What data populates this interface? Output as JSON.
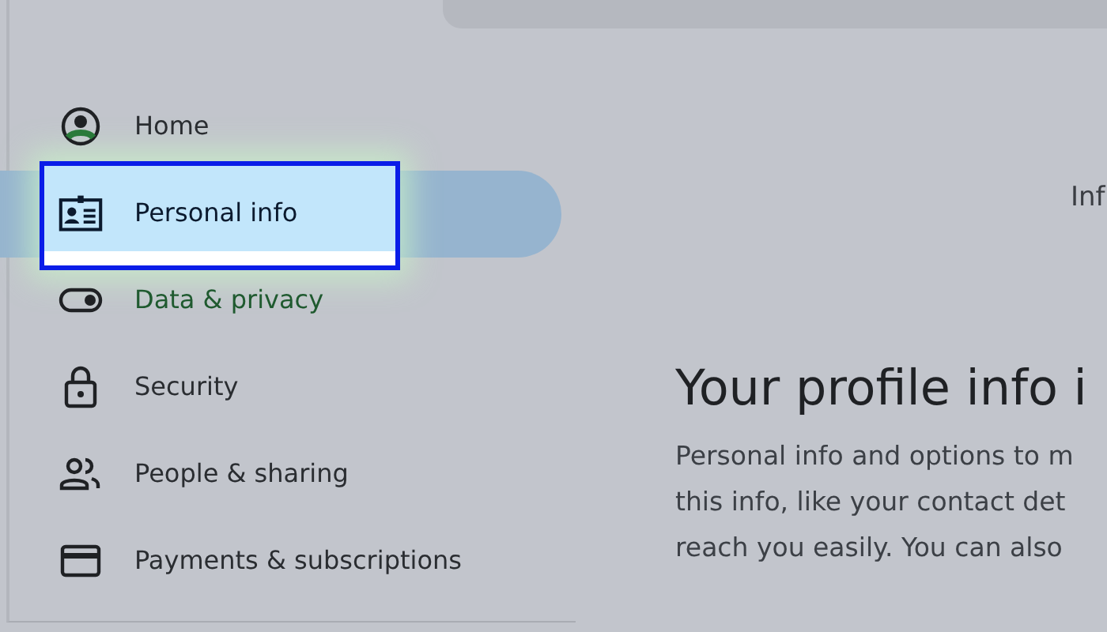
{
  "nav": {
    "items": [
      {
        "label": "Home",
        "kind": "home",
        "selected": false,
        "color": "#2a2d31"
      },
      {
        "label": "Personal info",
        "kind": "id-card",
        "selected": true,
        "color": "#0b1a2e"
      },
      {
        "label": "Data & privacy",
        "kind": "toggle",
        "selected": false,
        "color": "#1f5a2f"
      },
      {
        "label": "Security",
        "kind": "lock",
        "selected": false,
        "color": "#2a2d31"
      },
      {
        "label": "People & sharing",
        "kind": "people",
        "selected": false,
        "color": "#2a2d31"
      },
      {
        "label": "Payments & subscriptions",
        "kind": "card",
        "selected": false,
        "color": "#2a2d31"
      }
    ]
  },
  "main": {
    "top_label": "Inf",
    "heading": "Your profile info i",
    "description": [
      "Personal info and options to m",
      "this info, like your contact det",
      "reach you easily. You can also"
    ]
  }
}
